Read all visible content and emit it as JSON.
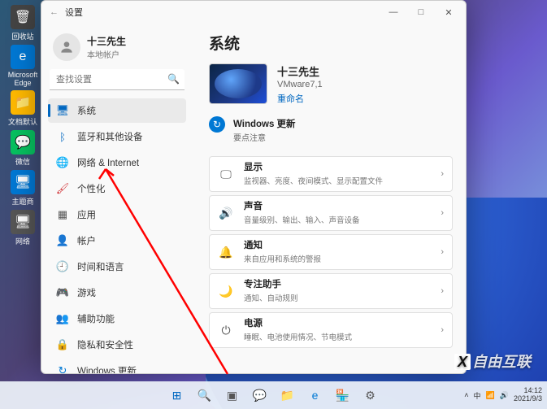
{
  "desktop": {
    "icons": [
      {
        "label": "回收站",
        "cls": "bin",
        "glyph": "🗑"
      },
      {
        "label": "Microsoft Edge",
        "cls": "edge",
        "glyph": "e"
      },
      {
        "label": "文档默认",
        "cls": "folder",
        "glyph": "📁"
      },
      {
        "label": "微信",
        "cls": "wc",
        "glyph": "💬"
      },
      {
        "label": "主题商",
        "cls": "tv",
        "glyph": "🖥"
      },
      {
        "label": "网络",
        "cls": "net",
        "glyph": "🖥"
      }
    ]
  },
  "window": {
    "title": "设置",
    "controls": {
      "min": "—",
      "max": "□",
      "close": "✕"
    },
    "back": "←"
  },
  "profile": {
    "name": "十三先生",
    "sub": "本地帐户"
  },
  "search": {
    "placeholder": "查找设置",
    "icon": "🔍"
  },
  "nav": [
    {
      "icon": "🖥",
      "label": "系统",
      "color": "#0067c0",
      "active": true
    },
    {
      "icon": "ᛒ",
      "label": "蓝牙和其他设备",
      "color": "#0067c0"
    },
    {
      "icon": "🌐",
      "label": "网络 & Internet",
      "color": "#0067c0"
    },
    {
      "icon": "🖌",
      "label": "个性化",
      "color": "#d13438"
    },
    {
      "icon": "▦",
      "label": "应用",
      "color": "#555"
    },
    {
      "icon": "👤",
      "label": "帐户",
      "color": "#c239b3"
    },
    {
      "icon": "🕘",
      "label": "时间和语言",
      "color": "#555"
    },
    {
      "icon": "🎮",
      "label": "游戏",
      "color": "#555"
    },
    {
      "icon": "👥",
      "label": "辅助功能",
      "color": "#0067c0"
    },
    {
      "icon": "🔒",
      "label": "隐私和安全性",
      "color": "#555"
    },
    {
      "icon": "↻",
      "label": "Windows 更新",
      "color": "#0078d4"
    }
  ],
  "main": {
    "title": "系统",
    "device": {
      "name": "十三先生",
      "model": "VMware7,1",
      "rename": "重命名"
    },
    "update": {
      "title": "Windows 更新",
      "sub": "要点注意"
    },
    "cards": [
      {
        "icon": "🖵",
        "title": "显示",
        "sub": "监视器、亮度、夜间模式、显示配置文件"
      },
      {
        "icon": "🔊",
        "title": "声音",
        "sub": "音量级别、输出、输入、声音设备"
      },
      {
        "icon": "🔔",
        "title": "通知",
        "sub": "来自应用和系统的警报"
      },
      {
        "icon": "🌙",
        "title": "专注助手",
        "sub": "通知、自动规则"
      },
      {
        "icon": "⏻",
        "title": "电源",
        "sub": "睡眠、电池使用情况、节电模式"
      }
    ]
  },
  "taskbar": {
    "items": [
      {
        "glyph": "⊞",
        "color": "#0067c0"
      },
      {
        "glyph": "🔍",
        "color": "#555"
      },
      {
        "glyph": "▣",
        "color": "#555"
      },
      {
        "glyph": "💬",
        "color": "#555"
      },
      {
        "glyph": "📁",
        "color": "#ffb900"
      },
      {
        "glyph": "e",
        "color": "#0078d4"
      },
      {
        "glyph": "🏪",
        "color": "#0078d4"
      },
      {
        "glyph": "⚙",
        "color": "#555"
      }
    ],
    "tray": {
      "ime": "中",
      "wifi": "📶",
      "vol": "🔊",
      "time": "14:12",
      "date": "2021/9/3"
    }
  },
  "watermark": "自由互联"
}
